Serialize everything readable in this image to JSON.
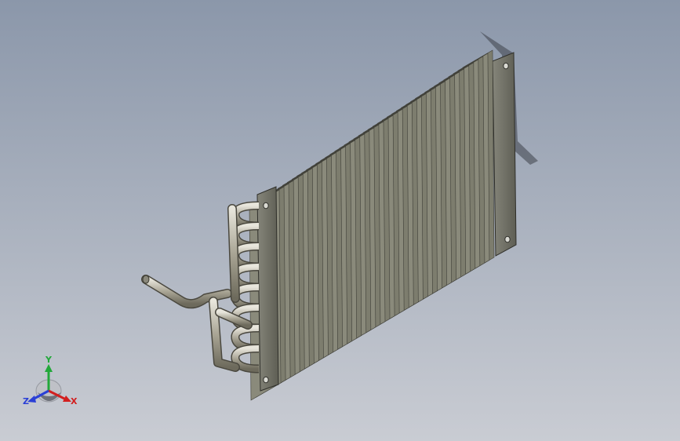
{
  "scene": {
    "background_top": "#8b97aa",
    "background_bottom": "#c9ccd3",
    "model": "fin-and-tube-heat-exchanger",
    "fin_color": "#7d7d6e",
    "fin_edge_color": "#3f3f38",
    "plate_color": "#6f6f62",
    "tube_color": "#b9b5a4"
  },
  "triad": {
    "y_label": "Y",
    "x_label": "X",
    "z_label": "Z",
    "y_color": "#22a83a",
    "x_color": "#d21f1f",
    "z_color": "#2a3fd6"
  }
}
